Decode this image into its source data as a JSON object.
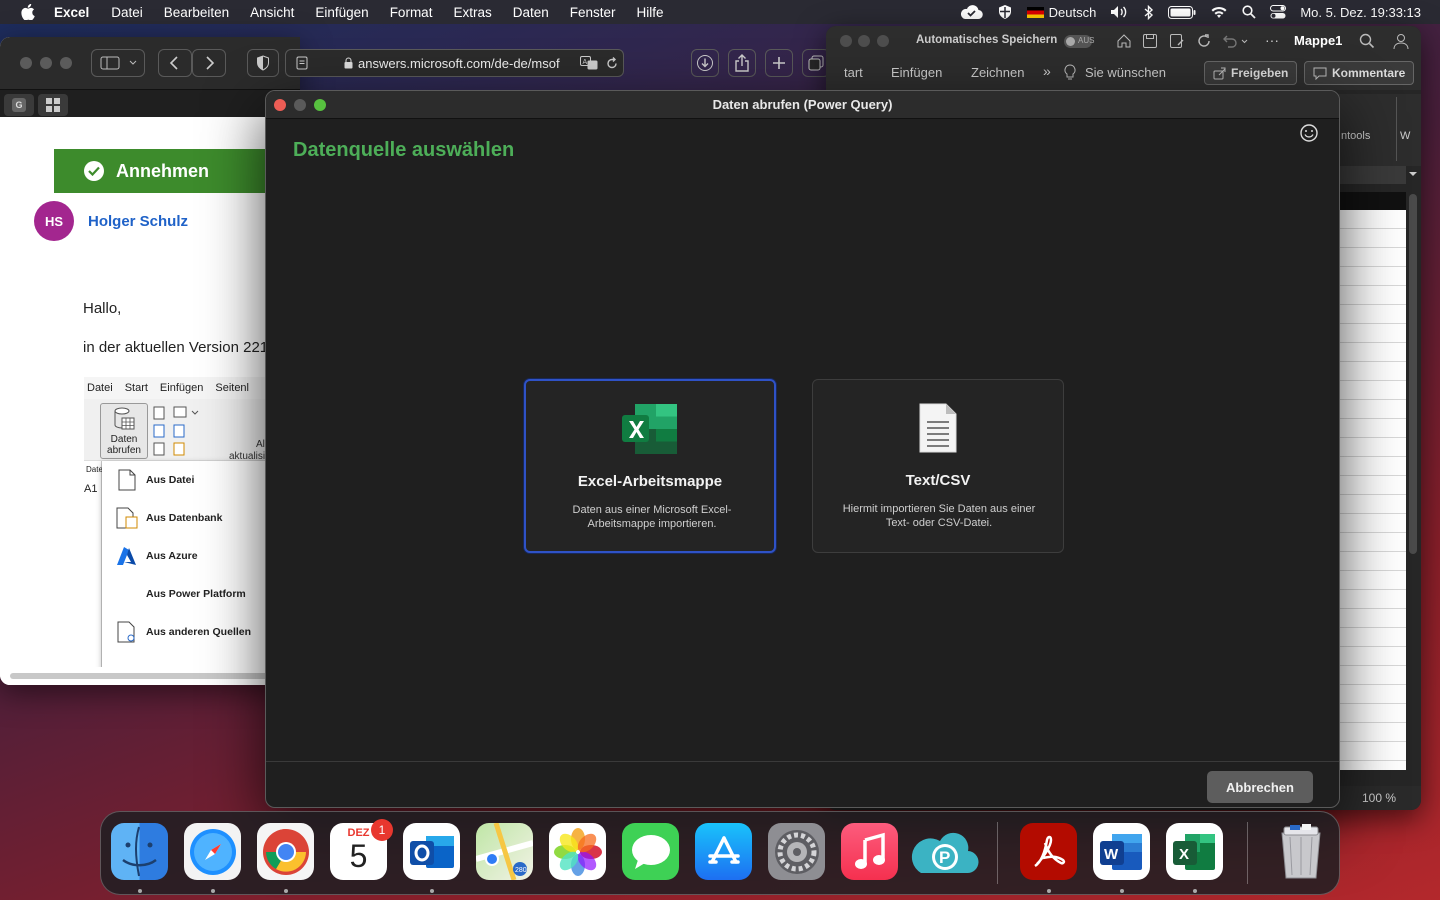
{
  "menubar": {
    "app": "Excel",
    "items": [
      "Datei",
      "Bearbeiten",
      "Ansicht",
      "Einfügen",
      "Format",
      "Extras",
      "Daten",
      "Fenster",
      "Hilfe"
    ],
    "language": "Deutsch",
    "datetime": "Mo. 5. Dez.  19:33:13"
  },
  "safari": {
    "url": "answers.microsoft.com/de-de/msof",
    "accept_label": "Annehmen",
    "avatar_initials": "HS",
    "author": "Holger Schulz",
    "greeting": "Hallo,",
    "body_line": "in der aktuellen Version 221",
    "shot_tabs": [
      "Datei",
      "Start",
      "Einfügen",
      "Seitenl"
    ],
    "daten_button": "Daten\nabrufen",
    "refresh_label_1": "All",
    "refresh_label_2": "aktualisi",
    "cell_ref": "A1",
    "name_box": "Date",
    "dropdown_items": [
      "Aus Datei",
      "Aus Datenbank",
      "Aus Azure",
      "Aus Power Platform",
      "Aus anderen Quellen"
    ]
  },
  "excel": {
    "autosave": "Automatisches Speichern",
    "autosave_state": "AUS",
    "doc_title": "Mappe1",
    "ribbon_tabs": [
      "tart",
      "Einfügen",
      "Zeichnen"
    ],
    "tell_me": "Sie wünschen",
    "share": "Freigeben",
    "comments": "Kommentare",
    "tools_fragment": "ntools",
    "zoom": "100 %"
  },
  "dialog": {
    "title": "Daten abrufen (Power Query)",
    "heading": "Datenquelle auswählen",
    "cards": [
      {
        "title": "Excel-Arbeitsmappe",
        "desc": "Daten aus einer Microsoft Excel-Arbeitsmappe importieren."
      },
      {
        "title": "Text/CSV",
        "desc": "Hiermit importieren Sie Daten aus einer Text- oder CSV-Datei."
      }
    ],
    "cancel": "Abbrechen"
  },
  "dock": {
    "calendar_month": "DEZ",
    "calendar_day": "5",
    "calendar_badge": "1",
    "apps": [
      "finder",
      "safari",
      "chrome",
      "calendar",
      "outlook",
      "maps",
      "photos",
      "messages",
      "app-store",
      "system-preferences",
      "music",
      "parallels",
      "acrobat",
      "word",
      "excel",
      "trash"
    ]
  },
  "colors": {
    "dialog_accent": "#4dae58",
    "selected_border": "#2f52c6",
    "accept_green": "#3d8b2c",
    "author_link": "#1f62c8"
  }
}
